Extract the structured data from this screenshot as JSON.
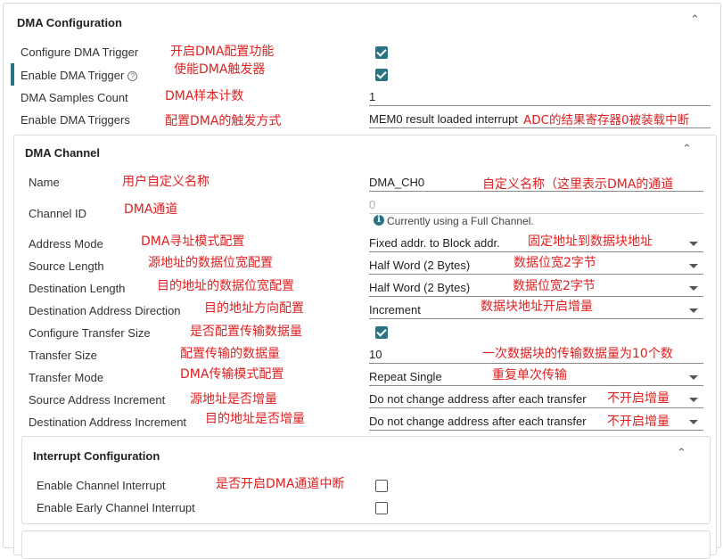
{
  "dma_config": {
    "title": "DMA Configuration",
    "rows": [
      {
        "label": "Configure DMA Trigger",
        "annotation": "开启DMA配置功能"
      },
      {
        "label": "Enable DMA Trigger",
        "annotation": "使能DMA触发器"
      },
      {
        "label": "DMA Samples Count",
        "annotation": "DMA样本计数",
        "value": "1"
      },
      {
        "label": "Enable DMA Triggers",
        "annotation": "配置DMA的触发方式",
        "value": "MEM0 result loaded interrupt",
        "value_annotation": "ADC的结果寄存器0被装载中断"
      }
    ]
  },
  "dma_channel": {
    "title": "DMA Channel",
    "rows": [
      {
        "label": "Name",
        "annotation": "用户自定义名称",
        "value": "DMA_CH0",
        "value_annotation": "自定义名称（这里表示DMA的通道"
      },
      {
        "label": "Channel ID",
        "annotation": "DMA通道",
        "value": "0",
        "info": "Currently using a Full Channel."
      },
      {
        "label": "Address Mode",
        "annotation": "DMA寻址模式配置",
        "value": "Fixed addr. to Block addr.",
        "value_annotation": "固定地址到数据块地址"
      },
      {
        "label": "Source Length",
        "annotation": "源地址的数据位宽配置",
        "value": "Half Word (2 Bytes)",
        "value_annotation": "数据位宽2字节"
      },
      {
        "label": "Destination Length",
        "annotation": "目的地址的数据位宽配置",
        "value": "Half Word (2 Bytes)",
        "value_annotation": "数据位宽2字节"
      },
      {
        "label": "Destination Address Direction",
        "annotation": "目的地址方向配置",
        "value": "Increment",
        "value_annotation": "数据块地址开启增量"
      },
      {
        "label": "Configure Transfer Size",
        "annotation": "是否配置传输数据量"
      },
      {
        "label": "Transfer Size",
        "annotation": "配置传输的数据量",
        "value": "10",
        "value_annotation": "一次数据块的传输数据量为10个数"
      },
      {
        "label": "Transfer Mode",
        "annotation": "DMA传输模式配置",
        "value": "Repeat Single",
        "value_annotation": "重复单次传输"
      },
      {
        "label": "Source Address Increment",
        "annotation": "源地址是否增量",
        "value": "Do not change address after each transfer",
        "value_annotation": "不开启增量"
      },
      {
        "label": "Destination Address Increment",
        "annotation": "目的地址是否增量",
        "value": "Do not change address after each transfer",
        "value_annotation": "不开启增量"
      }
    ]
  },
  "interrupt_config": {
    "title": "Interrupt Configuration",
    "rows": [
      {
        "label": "Enable Channel Interrupt",
        "annotation": "是否开启DMA通道中断"
      },
      {
        "label": "Enable Early Channel Interrupt"
      }
    ]
  },
  "colors": {
    "accent": "#2a7385",
    "annotation": "#e02020"
  },
  "icons": {
    "collapse": "chevron-up-icon",
    "help": "help-circle-icon",
    "info": "info-icon",
    "dropdown": "caret-down-icon"
  }
}
